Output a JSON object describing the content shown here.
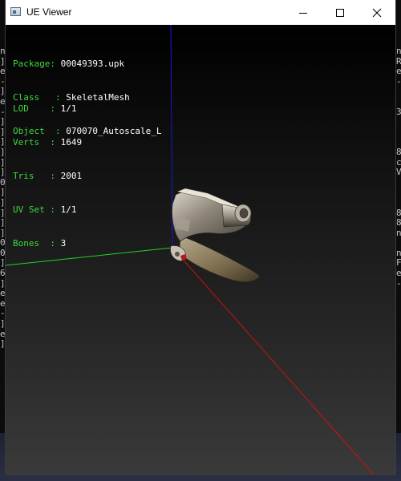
{
  "window": {
    "title": "UE Viewer",
    "minimize_icon": "minimize-icon",
    "maximize_icon": "maximize-icon",
    "close_icon": "close-icon"
  },
  "info": {
    "package_label": "Package",
    "package_value": "00049393.upk",
    "class_label": "Class",
    "class_value": "SkeletalMesh",
    "object_label": "Object",
    "object_value": "070070_Autoscale_L",
    "lod_label": "LOD",
    "lod_value": "1/1",
    "verts_label": "Verts",
    "verts_value": "1649",
    "tris_label": "Tris",
    "tris_value": "2001",
    "uvset_label": "UV Set",
    "uvset_value": "1/1",
    "bones_label": "Bones",
    "bones_value": "3"
  },
  "axes": {
    "x_color": "#d01010",
    "y_color": "#22d422",
    "z_color": "#1a1ad0"
  },
  "background_console": {
    "left_chars": [
      "n",
      "]",
      "e",
      "-",
      "]",
      "e",
      "-",
      "]",
      "]",
      "]",
      "]",
      "]",
      "]",
      "0",
      "]",
      "]",
      "]",
      "]",
      "]",
      "0",
      "0",
      "]",
      "6",
      "]",
      "e",
      "e",
      "-",
      "]",
      "e",
      "]"
    ],
    "right_chars": [
      "n",
      "R",
      "e",
      "-",
      "",
      "",
      "3",
      "",
      "",
      "",
      "8",
      "c",
      "V",
      "",
      "",
      "",
      "8",
      "8",
      "n",
      "",
      "n",
      "F",
      "e",
      "-",
      "",
      "",
      "",
      "",
      "",
      ""
    ]
  }
}
